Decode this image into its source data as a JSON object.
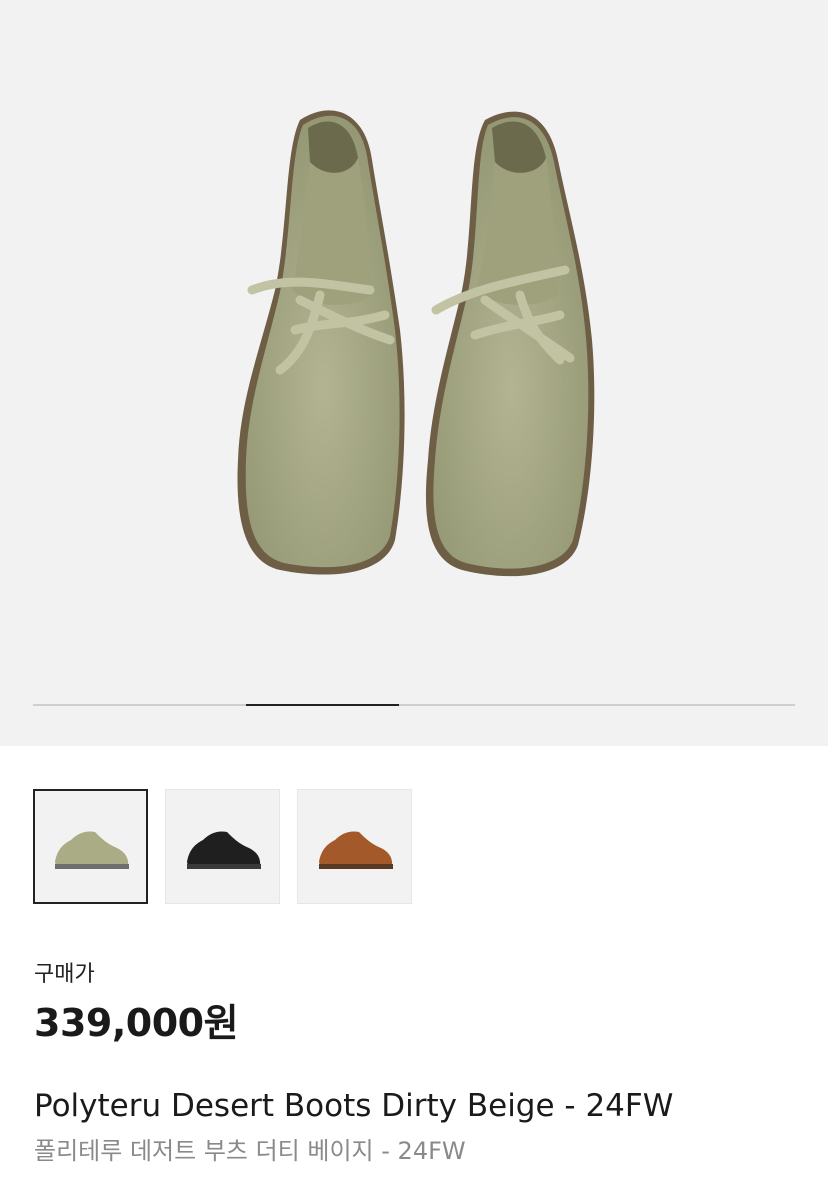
{
  "gallery": {
    "image_alt": "Polyteru Desert Boots Dirty Beige product photo",
    "progress": {
      "current_index": 2,
      "total": 5
    },
    "thumbnails": [
      {
        "color_name": "dirty-beige",
        "color": "#a9ac85",
        "selected": true
      },
      {
        "color_name": "black",
        "color": "#1f1f1f",
        "selected": false
      },
      {
        "color_name": "brown",
        "color": "#a4592a",
        "selected": false
      }
    ]
  },
  "product": {
    "price_label": "구매가",
    "price": "339,000원",
    "title_en": "Polyteru Desert Boots Dirty Beige - 24FW",
    "title_ko": "폴리테루 데저트 부츠 더티 베이지 - 24FW"
  },
  "colors": {
    "hero_background": "#f2f2f2",
    "boot_suede": "#a7a985",
    "boot_suede_dark": "#8d906a",
    "sole": "#6e5e45",
    "progress_active": "#222222",
    "progress_track": "#cfcfcf"
  }
}
